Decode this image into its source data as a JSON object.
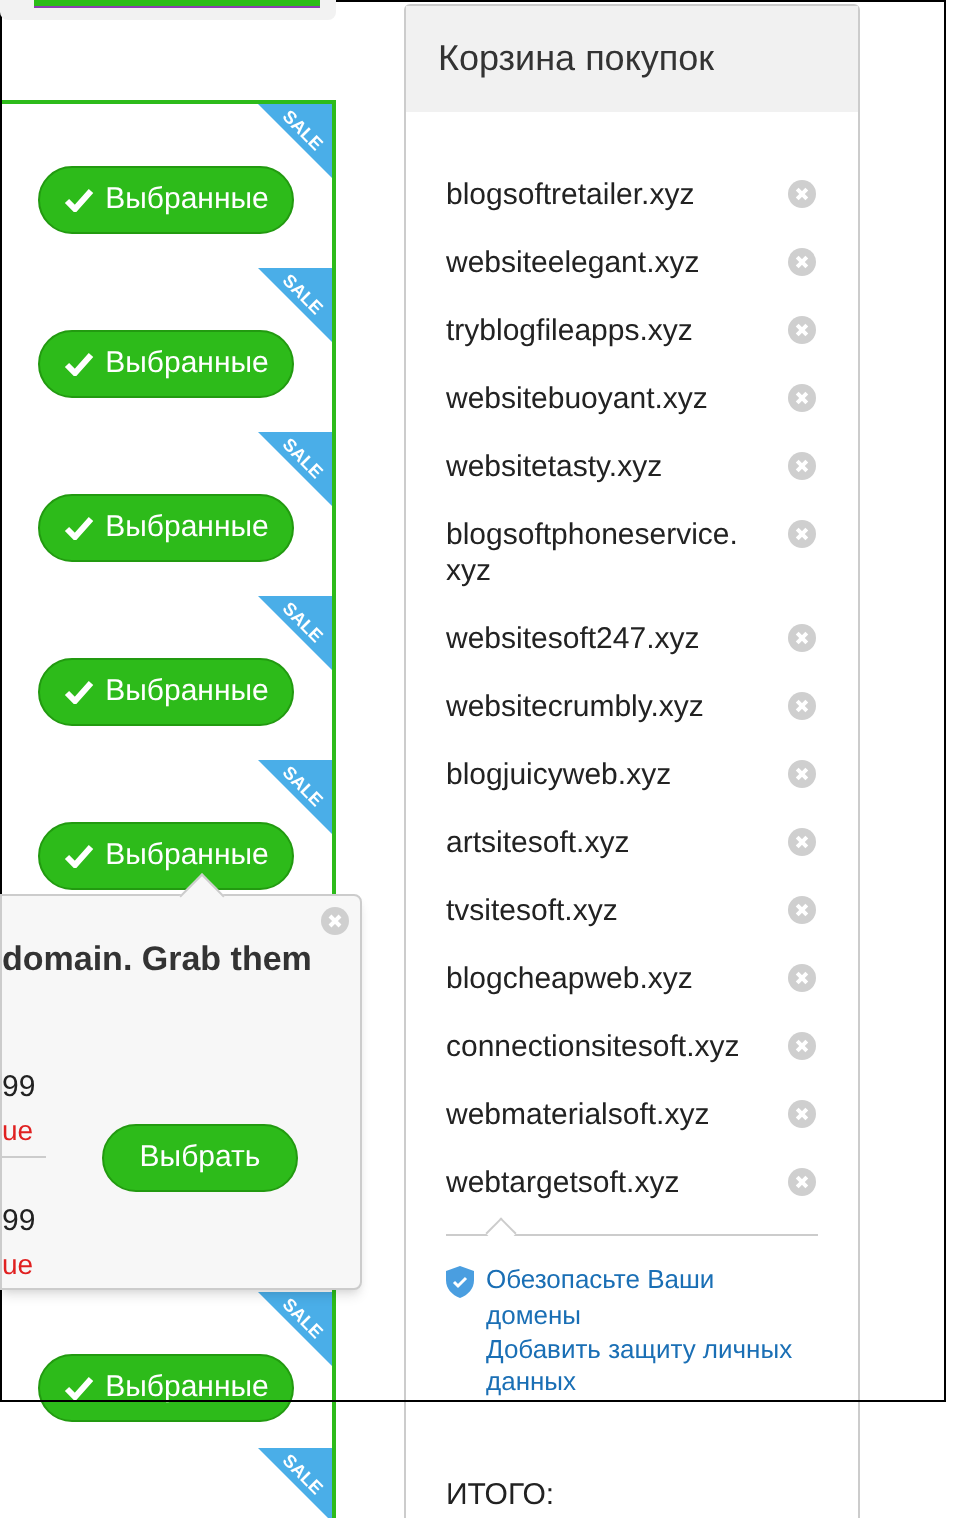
{
  "offers": [
    {
      "sale_badge": "SALE",
      "button": "Выбранные",
      "selected": true
    },
    {
      "sale_badge": "SALE",
      "button": "Выбранные",
      "selected": true
    },
    {
      "sale_badge": "SALE",
      "button": "Выбранные",
      "selected": true
    },
    {
      "sale_badge": "SALE",
      "button": "Выбранные",
      "selected": true
    },
    {
      "sale_badge": "SALE",
      "button": "Выбранные",
      "selected": true
    },
    {
      "sale_badge": "SALE",
      "button": "Выбранные",
      "selected": true
    },
    {
      "sale_badge": "SALE"
    }
  ],
  "popup": {
    "title": "domain. Grab them",
    "prices": [
      {
        "price": "99",
        "note": "ue"
      },
      {
        "price": "99",
        "note": "ue"
      }
    ],
    "button": "Выбрать"
  },
  "cart": {
    "title": "Корзина покупок",
    "items": [
      "blogsoftretailer.xyz",
      "websiteelegant.xyz",
      "tryblogfileapps.xyz",
      "websitebuoyant.xyz",
      "websitetasty.xyz",
      "blogsoftphoneservice.xyz",
      "websitesoft247.xyz",
      "websitecrumbly.xyz",
      "blogjuicyweb.xyz",
      "artsitesoft.xyz",
      "tvsitesoft.xyz",
      "blogcheapweb.xyz",
      "connectionsitesoft.xyz",
      "webmaterialsoft.xyz",
      "webtargetsoft.xyz"
    ],
    "links": [
      "Обезопасьте Ваши домены",
      "Добавить защиту личных данных"
    ],
    "total_label": "ИТОГО:"
  }
}
